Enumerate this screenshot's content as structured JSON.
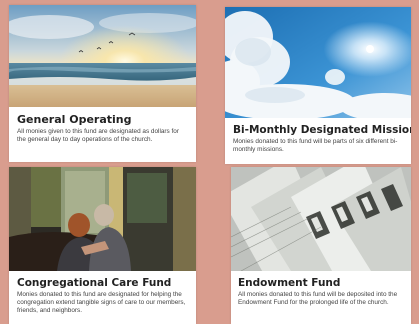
{
  "cards": [
    {
      "title": "General Operating",
      "description": "All monies given to this fund are designated as dollars for the general day to day operations of the church.",
      "image": "ocean-sunrise-image"
    },
    {
      "title": "Bi-Monthly Designated Mission",
      "description": "Monies donated to this fund will be parts of six different bi-monthly missions.",
      "image": "sky-sun-clouds-image"
    },
    {
      "title": "Congregational Care Fund",
      "description": "Monies donated to this fund are designated for helping the congregation extend tangible signs of care to our members, friends, and neighbors.",
      "image": "comforting-people-image"
    },
    {
      "title": "Endowment Fund",
      "description": "All monies donated to this fund will be deposited into the Endowment Fund for the prolonged life of the church.",
      "image": "dollar-bills-image"
    }
  ],
  "colors": {
    "background": "#d99d8e",
    "card": "#ffffff",
    "title": "#222222",
    "text": "#444444"
  }
}
